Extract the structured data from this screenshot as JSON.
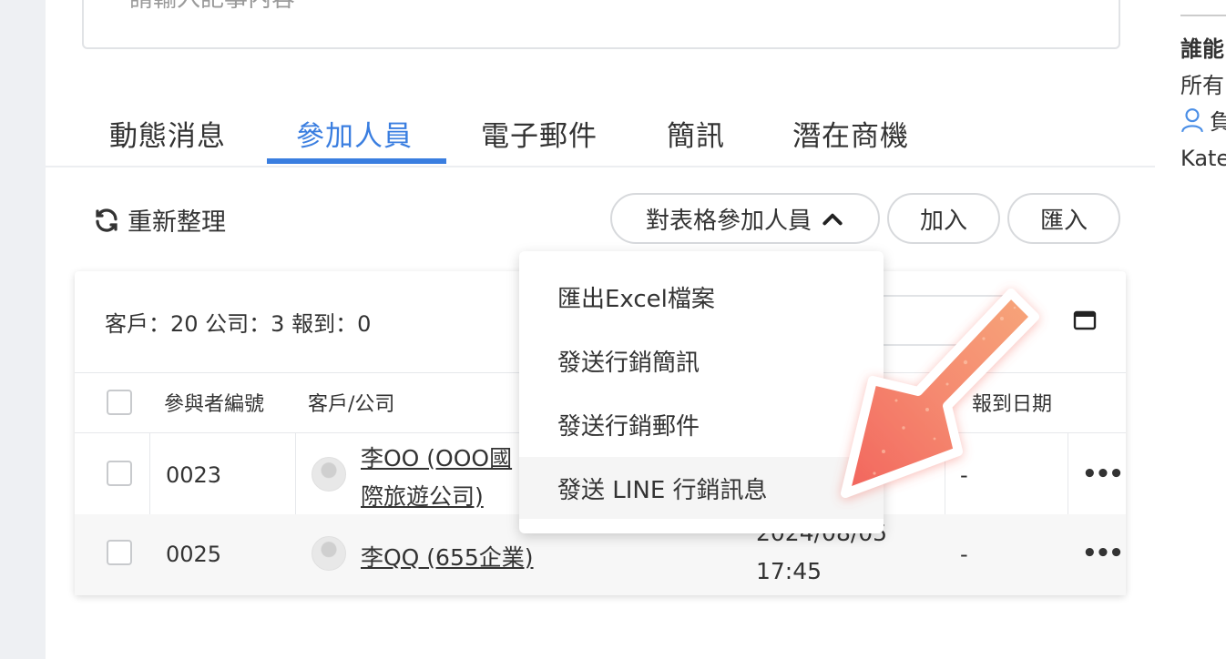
{
  "note": {
    "placeholder": "請輸入記事內容"
  },
  "tabs": [
    {
      "label": "動態消息"
    },
    {
      "label": "參加人員"
    },
    {
      "label": "電子郵件"
    },
    {
      "label": "簡訊"
    },
    {
      "label": "潛在商機"
    }
  ],
  "toolbar": {
    "refresh_label": "重新整理",
    "table_menu_label": "對表格參加人員",
    "add_label": "加入",
    "import_label": "匯入"
  },
  "summary": "客戶：20 公司：3 報到：0",
  "table": {
    "headers": [
      "參與者編號",
      "客戶/公司",
      "報到日期"
    ],
    "rows": [
      {
        "id": "0023",
        "customer_line1": "李OO (OOO國",
        "customer_line2": "際旅遊公司)",
        "checkin": "-"
      },
      {
        "id": "0025",
        "customer": "李QQ (655企業)",
        "date_line1": "2024/08/05",
        "date_line2": "17:45",
        "checkin": "-"
      }
    ]
  },
  "dropdown": {
    "items": [
      {
        "label": "匯出Excel檔案"
      },
      {
        "label": "發送行銷簡訊"
      },
      {
        "label": "發送行銷郵件"
      },
      {
        "label": "發送 LINE 行銷訊息"
      }
    ]
  },
  "right_panel": {
    "line1": "誰能",
    "line2": "所有",
    "line3": "負",
    "line4": "Kate"
  },
  "colors": {
    "accent": "#3a7ee0",
    "arrow": "#f46a5e"
  },
  "icons": [
    "refresh-icon",
    "chevron-up-icon",
    "window-icon",
    "more-icon",
    "user-icon",
    "avatar-icon",
    "arrow-pointer-icon"
  ]
}
